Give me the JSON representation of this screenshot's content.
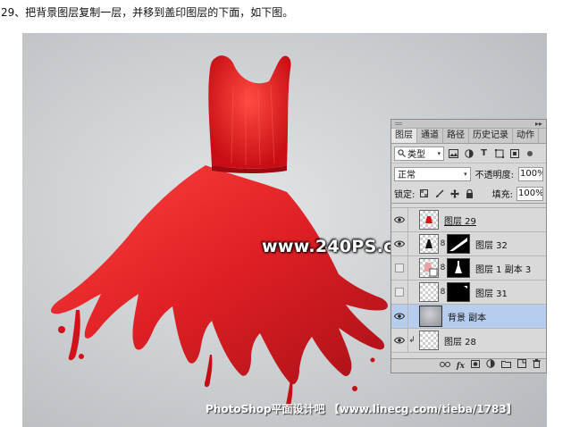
{
  "instruction": {
    "text": "29、把背景图层复制一层，并移到盖印图层的下面，如下图。"
  },
  "artwork": {
    "watermark": "www.240PS.com",
    "credit": "PhotoShop平面设计吧 【www.linecg.com/tieba/1783】",
    "dress_color": "#e0161b",
    "background_color": "#c9ccd0"
  },
  "layers_panel": {
    "tabs": [
      {
        "label": "图层",
        "active": true
      },
      {
        "label": "通道",
        "active": false
      },
      {
        "label": "路径",
        "active": false
      },
      {
        "label": "历史记录",
        "active": false
      },
      {
        "label": "动作",
        "active": false
      }
    ],
    "filter": {
      "search_icon": "search-icon",
      "kind_label": "类型"
    },
    "blend": {
      "mode": "正常",
      "opacity_label": "不透明度:",
      "opacity_value": "100%"
    },
    "lock": {
      "label": "锁定:",
      "fill_label": "填充:",
      "fill_value": "100%"
    },
    "layers": [
      {
        "name": "图层 29",
        "visible": true,
        "selected": false
      },
      {
        "name": "图层 32",
        "visible": true,
        "selected": false
      },
      {
        "name": "图层 1 副本 3",
        "visible": false,
        "selected": false
      },
      {
        "name": "图层 31",
        "visible": false,
        "selected": false
      },
      {
        "name": "背景 副本",
        "visible": true,
        "selected": true
      },
      {
        "name": "图层 28",
        "visible": true,
        "selected": false
      }
    ],
    "footer_icons": [
      "link-icon",
      "fx-icon",
      "mask-icon",
      "adjustment-icon",
      "group-folder-icon",
      "new-layer-icon",
      "trash-icon"
    ]
  }
}
